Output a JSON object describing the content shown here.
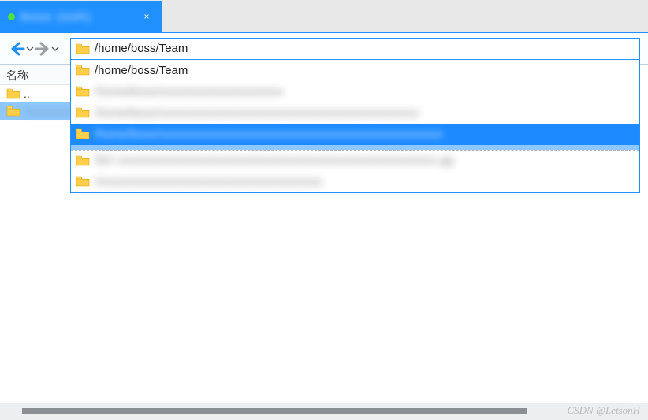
{
  "tab": {
    "title": "boss (ssh)",
    "close": "×"
  },
  "addressbar": {
    "path": "/home/boss/Team"
  },
  "dropdown": {
    "items": [
      {
        "label": "/home/boss/Team",
        "blurred": false,
        "selected": false
      },
      {
        "label": "/home/boss/xxxxxxxxxxxxxxxxxxxxx",
        "blurred": true,
        "selected": false
      },
      {
        "label": "/home/boss/xxxxxxxxxxxxxxxxxxxxxxxxxxxxxxxxxxxxxxxxxxxx",
        "blurred": true,
        "selected": false
      },
      {
        "label": "/home/boss/xxxxxxxxxxxxxxxxxxxxxxxxxxxxxxxxxxxxxxxxxxxxxxxx",
        "blurred": true,
        "selected": true
      },
      {
        "label": "/b/n xxxxxxxxxxxxxxxxxxxxxxxxxxxxxxxxxxxxxxxxxxxxxxxxxxxxxx gg",
        "blurred": true,
        "selected": false
      },
      {
        "label": "/xxxxxxxxxxxxxxxxxxxxxxxxxxxxxxxxxxxxxx",
        "blurred": true,
        "selected": false
      }
    ]
  },
  "sidebar": {
    "header": "名称",
    "items": [
      {
        "label": "..",
        "blurred": false,
        "selected": false
      },
      {
        "label": "xxxxxxxxxx",
        "blurred": true,
        "selected": true
      }
    ]
  },
  "watermark": "CSDN @LetsonH"
}
